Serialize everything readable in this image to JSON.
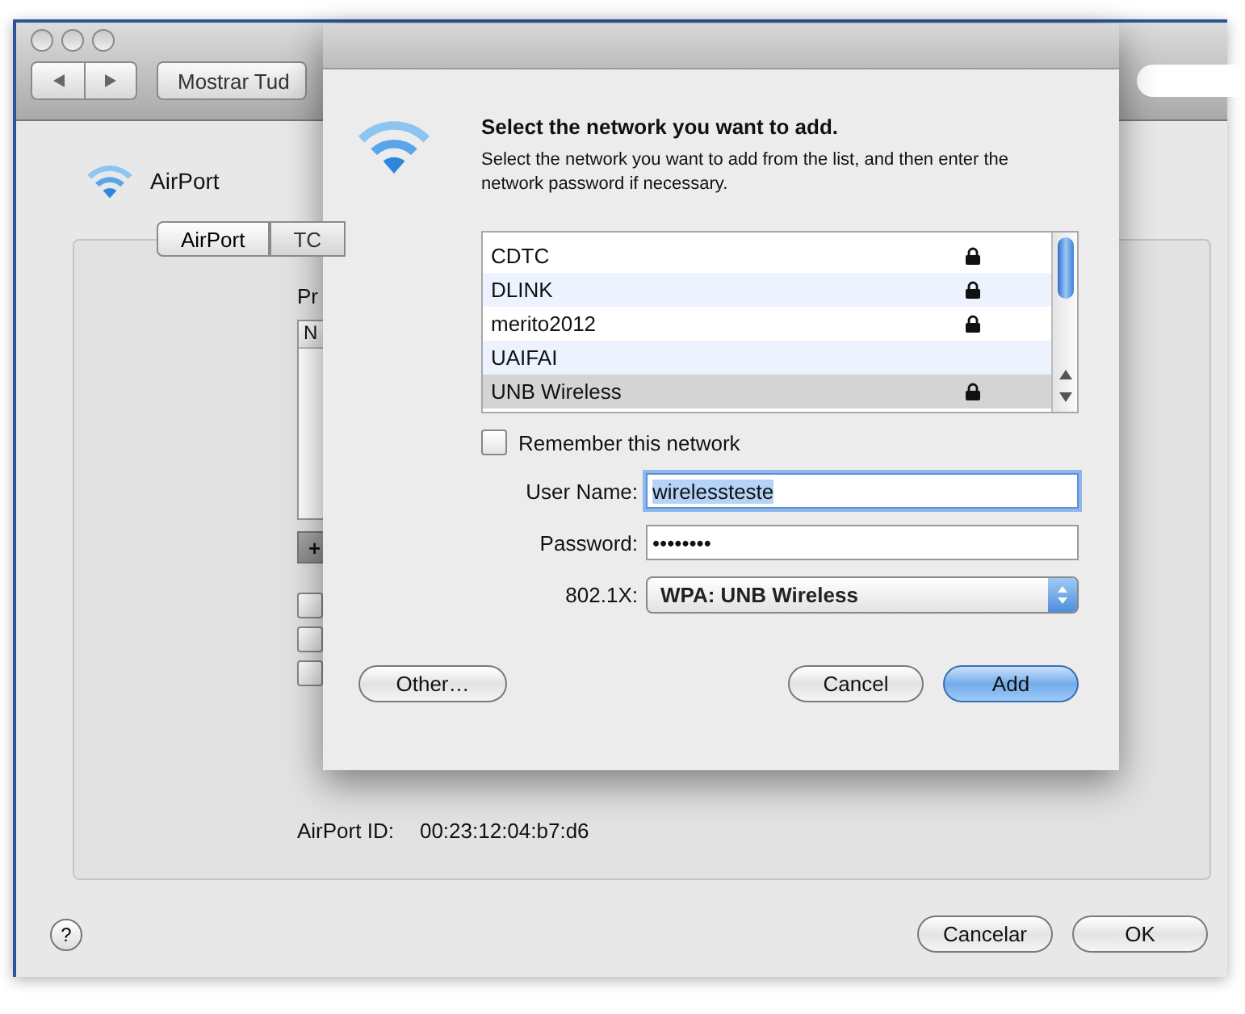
{
  "preferences_window": {
    "toolbar": {
      "show_all_button": "Mostrar Tud"
    },
    "header": {
      "title": "AirPort"
    },
    "tabs": [
      {
        "label": "AirPort",
        "selected": true
      },
      {
        "label": "TC",
        "selected": false
      }
    ],
    "panel": {
      "label_fragment": "Pr",
      "table_header_fragment": "N",
      "add_button": "+",
      "checkboxes": [
        {
          "checked": false
        },
        {
          "checked": false
        },
        {
          "checked": false
        }
      ],
      "airport_id_label": "AirPort ID:",
      "airport_id": "00:23:12:04:b7:d6"
    },
    "footer": {
      "help": "?",
      "buttons": [
        {
          "label": "Cancelar",
          "default": false
        },
        {
          "label": "OK",
          "default": false
        }
      ]
    }
  },
  "sheet": {
    "title": "Select the network you want to add.",
    "description": "Select the network you want to add from the list, and then enter the network password if necessary.",
    "networks": [
      {
        "name": "CDTC",
        "secured": true,
        "selected": false
      },
      {
        "name": "DLINK",
        "secured": true,
        "selected": false
      },
      {
        "name": "merito2012",
        "secured": true,
        "selected": false
      },
      {
        "name": "UAIFAI",
        "secured": false,
        "selected": false
      },
      {
        "name": "UNB Wireless",
        "secured": true,
        "selected": true
      }
    ],
    "remember": {
      "label": "Remember this network",
      "checked": false
    },
    "fields": [
      {
        "label": "User Name:",
        "value": "wirelessteste",
        "focused": true
      },
      {
        "label": "Password:",
        "value": "••••••••",
        "focused": false
      }
    ],
    "security": {
      "label": "802.1X:",
      "value": "WPA: UNB Wireless"
    },
    "other_button": "Other…",
    "buttons": [
      {
        "label": "Cancel",
        "default": false
      },
      {
        "label": "Add",
        "default": true
      }
    ]
  }
}
